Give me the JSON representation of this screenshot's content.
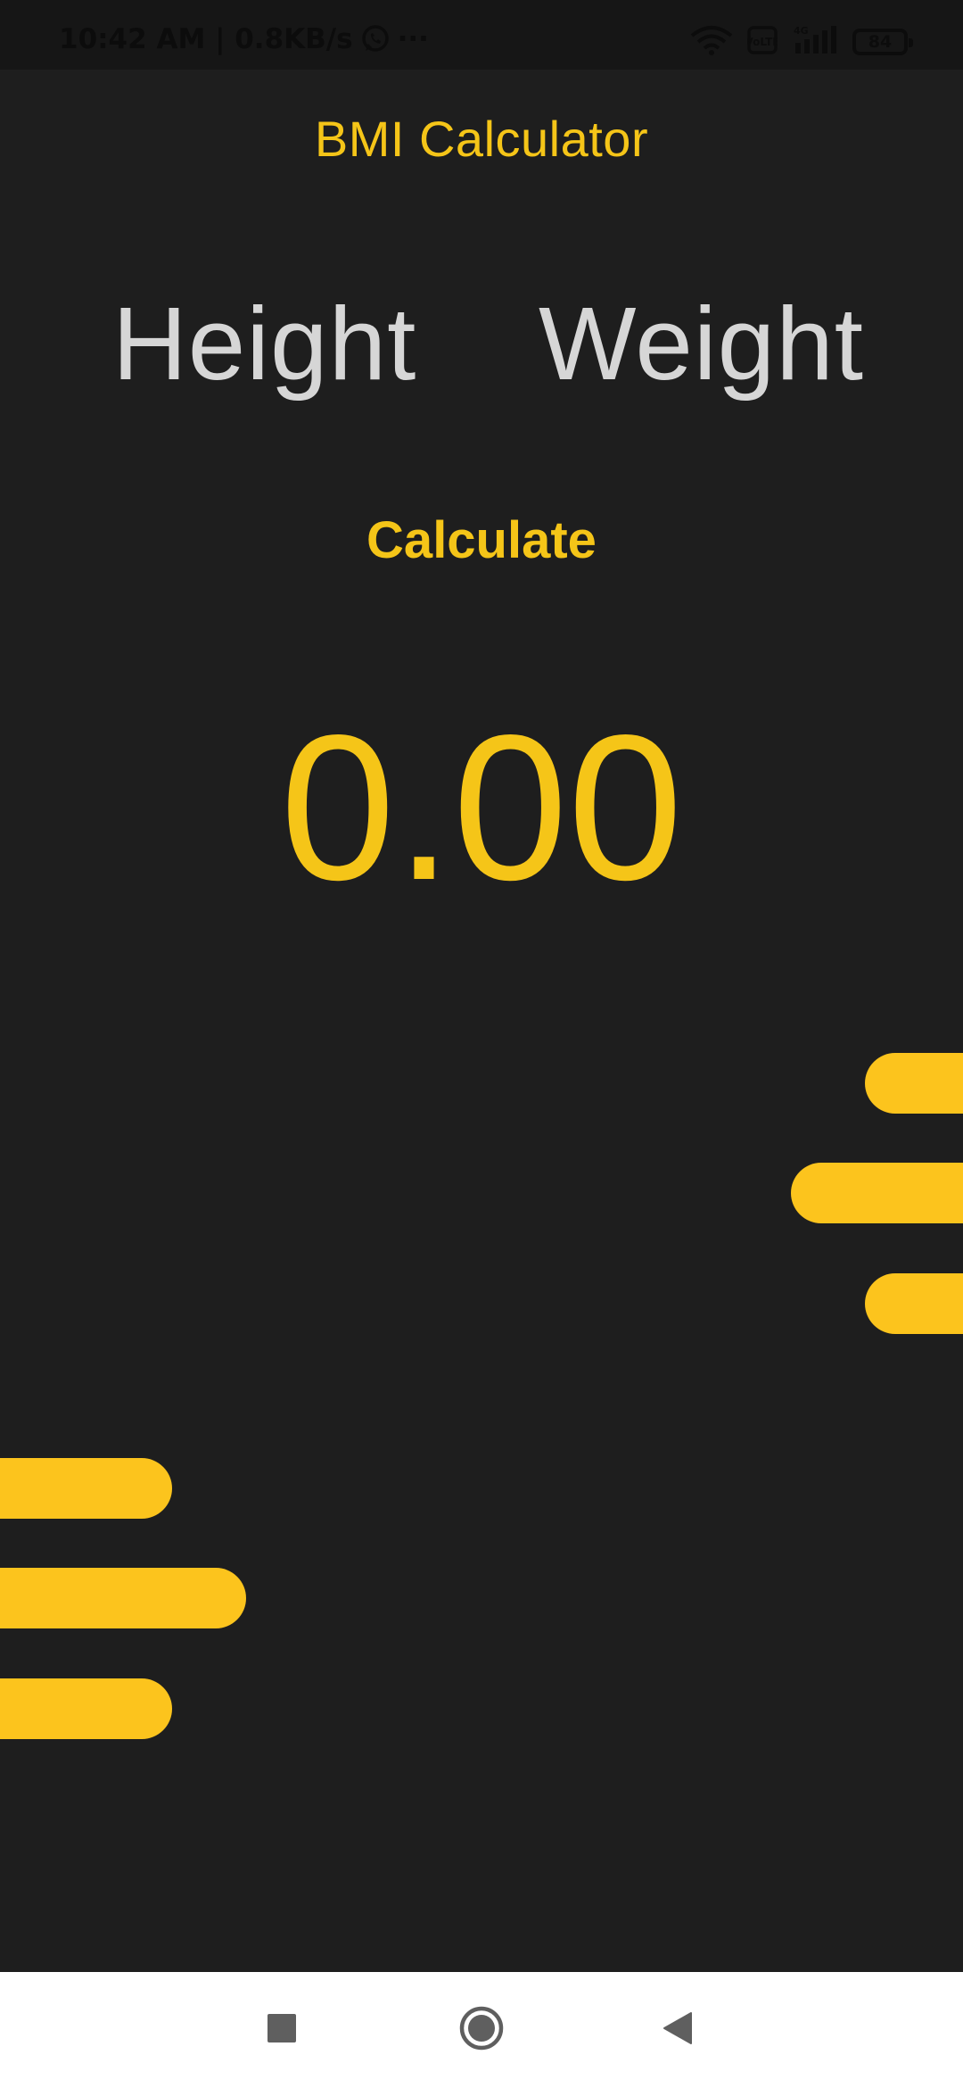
{
  "status_bar": {
    "time_speed": "10:42 AM | 0.8KB/s",
    "more": "···",
    "volte": "VoLTE",
    "network": "4G",
    "battery": "84"
  },
  "app": {
    "title": "BMI Calculator",
    "height_label": "Height",
    "weight_label": "Weight",
    "calculate_label": "Calculate",
    "result": "0.00"
  },
  "colors": {
    "background": "#1e1e1e",
    "accent": "#f5c518",
    "label": "#d6d6d6",
    "nav_bar": "#ffffff"
  },
  "icons": {
    "status": [
      "whatsapp-icon",
      "wifi-icon",
      "volte-icon",
      "signal-icon",
      "battery-icon"
    ],
    "navigation": [
      "recents-icon",
      "home-icon",
      "back-icon"
    ]
  }
}
